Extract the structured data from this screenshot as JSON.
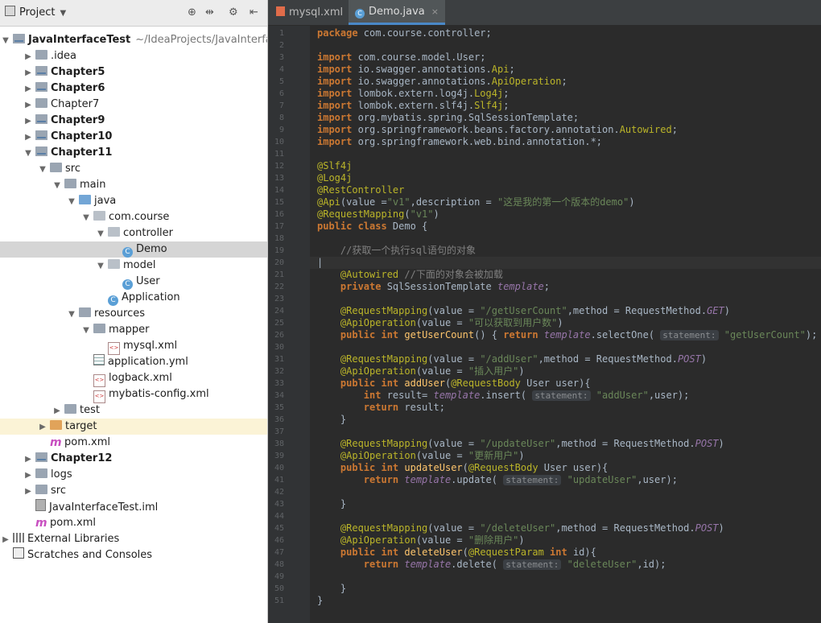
{
  "project": {
    "title": "Project",
    "tree": [
      {
        "label": "JavaInterfaceTest",
        "path": "~/IdeaProjects/JavaInterface",
        "bold": true,
        "depth": 0,
        "arrow": "▼",
        "icon": "module-folder"
      },
      {
        "label": ".idea",
        "depth": 1,
        "arrow": "▶",
        "icon": "folder"
      },
      {
        "label": "Chapter5",
        "bold": true,
        "depth": 1,
        "arrow": "▶",
        "icon": "module-folder"
      },
      {
        "label": "Chapter6",
        "bold": true,
        "depth": 1,
        "arrow": "▶",
        "icon": "module-folder"
      },
      {
        "label": "Chapter7",
        "depth": 1,
        "arrow": "▶",
        "icon": "folder"
      },
      {
        "label": "Chapter9",
        "bold": true,
        "depth": 1,
        "arrow": "▶",
        "icon": "module-folder"
      },
      {
        "label": "Chapter10",
        "bold": true,
        "depth": 1,
        "arrow": "▶",
        "icon": "module-folder"
      },
      {
        "label": "Chapter11",
        "bold": true,
        "depth": 1,
        "arrow": "▼",
        "icon": "module-folder"
      },
      {
        "label": "src",
        "depth": 2,
        "arrow": "▼",
        "icon": "folder"
      },
      {
        "label": "main",
        "depth": 3,
        "arrow": "▼",
        "icon": "folder"
      },
      {
        "label": "java",
        "depth": 4,
        "arrow": "▼",
        "icon": "folder-blue"
      },
      {
        "label": "com.course",
        "depth": 5,
        "arrow": "▼",
        "icon": "package"
      },
      {
        "label": "controller",
        "depth": 6,
        "arrow": "▼",
        "icon": "package"
      },
      {
        "label": "Demo",
        "depth": 7,
        "arrow": "",
        "icon": "class",
        "selected": true
      },
      {
        "label": "model",
        "depth": 6,
        "arrow": "▼",
        "icon": "package"
      },
      {
        "label": "User",
        "depth": 7,
        "arrow": "",
        "icon": "class"
      },
      {
        "label": "Application",
        "depth": 6,
        "arrow": "",
        "icon": "class"
      },
      {
        "label": "resources",
        "depth": 4,
        "arrow": "▼",
        "icon": "folder"
      },
      {
        "label": "mapper",
        "depth": 5,
        "arrow": "▼",
        "icon": "folder"
      },
      {
        "label": "mysql.xml",
        "depth": 6,
        "arrow": "",
        "icon": "xml"
      },
      {
        "label": "application.yml",
        "depth": 5,
        "arrow": "",
        "icon": "yml"
      },
      {
        "label": "logback.xml",
        "depth": 5,
        "arrow": "",
        "icon": "xml"
      },
      {
        "label": "mybatis-config.xml",
        "depth": 5,
        "arrow": "",
        "icon": "xml"
      },
      {
        "label": "test",
        "depth": 3,
        "arrow": "▶",
        "icon": "folder"
      },
      {
        "label": "target",
        "depth": 2,
        "arrow": "▶",
        "icon": "folder-orange",
        "highlight": true
      },
      {
        "label": "pom.xml",
        "depth": 2,
        "arrow": "",
        "icon": "maven"
      },
      {
        "label": "Chapter12",
        "bold": true,
        "depth": 1,
        "arrow": "▶",
        "icon": "module-folder"
      },
      {
        "label": "logs",
        "depth": 1,
        "arrow": "▶",
        "icon": "folder"
      },
      {
        "label": "src",
        "depth": 1,
        "arrow": "▶",
        "icon": "folder"
      },
      {
        "label": "JavaInterfaceTest.iml",
        "depth": 1,
        "arrow": "",
        "icon": "iml"
      },
      {
        "label": "pom.xml",
        "depth": 1,
        "arrow": "",
        "icon": "maven"
      },
      {
        "label": "External Libraries",
        "depth": 0,
        "arrow": "▶",
        "icon": "libraries"
      },
      {
        "label": "Scratches and Consoles",
        "depth": 0,
        "arrow": "",
        "icon": "scratches"
      }
    ]
  },
  "tabs": [
    {
      "label": "mysql.xml",
      "type": "xml",
      "active": false
    },
    {
      "label": "Demo.java",
      "type": "class",
      "active": true
    }
  ],
  "code_lines": [
    [
      [
        "kw",
        "package "
      ],
      [
        "",
        "com.course.controller;"
      ]
    ],
    [],
    [
      [
        "kw",
        "import "
      ],
      [
        "",
        "com.course.model.User;"
      ]
    ],
    [
      [
        "kw",
        "import "
      ],
      [
        "",
        "io.swagger.annotations."
      ],
      [
        "an",
        "Api"
      ],
      [
        "",
        ";"
      ]
    ],
    [
      [
        "kw",
        "import "
      ],
      [
        "",
        "io.swagger.annotations."
      ],
      [
        "an",
        "ApiOperation"
      ],
      [
        "",
        ";"
      ]
    ],
    [
      [
        "kw",
        "import "
      ],
      [
        "",
        "lombok.extern.log4j."
      ],
      [
        "an",
        "Log4j"
      ],
      [
        "",
        ";"
      ]
    ],
    [
      [
        "kw",
        "import "
      ],
      [
        "",
        "lombok.extern.slf4j."
      ],
      [
        "an",
        "Slf4j"
      ],
      [
        "",
        ";"
      ]
    ],
    [
      [
        "kw",
        "import "
      ],
      [
        "",
        "org.mybatis.spring.SqlSessionTemplate;"
      ]
    ],
    [
      [
        "kw",
        "import "
      ],
      [
        "",
        "org.springframework.beans.factory.annotation."
      ],
      [
        "an",
        "Autowired"
      ],
      [
        "",
        ";"
      ]
    ],
    [
      [
        "kw",
        "import "
      ],
      [
        "",
        "org.springframework.web.bind.annotation.*;"
      ]
    ],
    [],
    [
      [
        "an",
        "@Slf4j"
      ]
    ],
    [
      [
        "an",
        "@Log4j"
      ]
    ],
    [
      [
        "an",
        "@RestController"
      ]
    ],
    [
      [
        "an",
        "@Api"
      ],
      [
        "",
        "(value ="
      ],
      [
        "st",
        "\"v1\""
      ],
      [
        "",
        ",description = "
      ],
      [
        "st",
        "\"这是我的第一个版本的demo\""
      ],
      [
        "",
        ")"
      ]
    ],
    [
      [
        "an",
        "@RequestMapping"
      ],
      [
        "",
        "("
      ],
      [
        "st",
        "\"v1\""
      ],
      [
        "",
        ")"
      ]
    ],
    [
      [
        "kw",
        "public class "
      ],
      [
        "",
        "Demo {"
      ]
    ],
    [],
    [
      [
        "",
        "    "
      ],
      [
        "cm",
        "//获取一个执行sql语句的对象"
      ]
    ],
    [
      [
        "",
        "|"
      ]
    ],
    [
      [
        "",
        "    "
      ],
      [
        "an",
        "@Autowired "
      ],
      [
        "cm",
        "//下面的对象会被加载"
      ]
    ],
    [
      [
        "",
        "    "
      ],
      [
        "kw",
        "private "
      ],
      [
        "",
        "SqlSessionTemplate "
      ],
      [
        "it",
        "template"
      ],
      [
        "",
        ";"
      ]
    ],
    [],
    [
      [
        "",
        "    "
      ],
      [
        "an",
        "@RequestMapping"
      ],
      [
        "",
        "(value = "
      ],
      [
        "st",
        "\"/getUserCount\""
      ],
      [
        "",
        ",method = RequestMethod."
      ],
      [
        "it",
        "GET"
      ],
      [
        "",
        ")"
      ]
    ],
    [
      [
        "",
        "    "
      ],
      [
        "an",
        "@ApiOperation"
      ],
      [
        "",
        "(value = "
      ],
      [
        "st",
        "\"可以获取到用户数\""
      ],
      [
        "",
        ")"
      ]
    ],
    [
      [
        "",
        "    "
      ],
      [
        "kw",
        "public int "
      ],
      [
        "fn",
        "getUserCount"
      ],
      [
        "",
        "() { "
      ],
      [
        "kw",
        "return "
      ],
      [
        "it",
        "template"
      ],
      [
        "",
        ".selectOne( "
      ],
      [
        "hint",
        "statement:"
      ],
      [
        "st",
        " \"getUserCount\""
      ],
      [
        "",
        "); }"
      ]
    ],
    [],
    [
      [
        "",
        "    "
      ],
      [
        "an",
        "@RequestMapping"
      ],
      [
        "",
        "(value = "
      ],
      [
        "st",
        "\"/addUser\""
      ],
      [
        "",
        ",method = RequestMethod."
      ],
      [
        "it",
        "POST"
      ],
      [
        "",
        ")"
      ]
    ],
    [
      [
        "",
        "    "
      ],
      [
        "an",
        "@ApiOperation"
      ],
      [
        "",
        "(value = "
      ],
      [
        "st",
        "\"插入用户\""
      ],
      [
        "",
        ")"
      ]
    ],
    [
      [
        "",
        "    "
      ],
      [
        "kw",
        "public int "
      ],
      [
        "fn",
        "addUser"
      ],
      [
        "",
        "("
      ],
      [
        "an",
        "@RequestBody "
      ],
      [
        "",
        "User user){"
      ]
    ],
    [
      [
        "",
        "        "
      ],
      [
        "kw",
        "int "
      ],
      [
        "",
        "result= "
      ],
      [
        "it",
        "template"
      ],
      [
        "",
        ".insert( "
      ],
      [
        "hint",
        "statement:"
      ],
      [
        "st",
        " \"addUser\""
      ],
      [
        "",
        ",user);"
      ]
    ],
    [
      [
        "",
        "        "
      ],
      [
        "kw",
        "return "
      ],
      [
        "",
        "result;"
      ]
    ],
    [
      [
        "",
        "    }"
      ]
    ],
    [],
    [
      [
        "",
        "    "
      ],
      [
        "an",
        "@RequestMapping"
      ],
      [
        "",
        "(value = "
      ],
      [
        "st",
        "\"/updateUser\""
      ],
      [
        "",
        ",method = RequestMethod."
      ],
      [
        "it",
        "POST"
      ],
      [
        "",
        ")"
      ]
    ],
    [
      [
        "",
        "    "
      ],
      [
        "an",
        "@ApiOperation"
      ],
      [
        "",
        "(value = "
      ],
      [
        "st",
        "\"更新用户\""
      ],
      [
        "",
        ")"
      ]
    ],
    [
      [
        "",
        "    "
      ],
      [
        "kw",
        "public int "
      ],
      [
        "fn",
        "updateUser"
      ],
      [
        "",
        "("
      ],
      [
        "an",
        "@RequestBody "
      ],
      [
        "",
        "User user){"
      ]
    ],
    [
      [
        "",
        "        "
      ],
      [
        "kw",
        "return "
      ],
      [
        "it",
        "template"
      ],
      [
        "",
        ".update( "
      ],
      [
        "hint",
        "statement:"
      ],
      [
        "st",
        " \"updateUser\""
      ],
      [
        "",
        ",user);"
      ]
    ],
    [],
    [
      [
        "",
        "    }"
      ]
    ],
    [],
    [
      [
        "",
        "    "
      ],
      [
        "an",
        "@RequestMapping"
      ],
      [
        "",
        "(value = "
      ],
      [
        "st",
        "\"/deleteUser\""
      ],
      [
        "",
        ",method = RequestMethod."
      ],
      [
        "it",
        "POST"
      ],
      [
        "",
        ")"
      ]
    ],
    [
      [
        "",
        "    "
      ],
      [
        "an",
        "@ApiOperation"
      ],
      [
        "",
        "(value = "
      ],
      [
        "st",
        "\"删除用户\""
      ],
      [
        "",
        ")"
      ]
    ],
    [
      [
        "",
        "    "
      ],
      [
        "kw",
        "public int "
      ],
      [
        "fn",
        "deleteUser"
      ],
      [
        "",
        "("
      ],
      [
        "an",
        "@RequestParam "
      ],
      [
        "kw",
        "int "
      ],
      [
        "",
        "id){"
      ]
    ],
    [
      [
        "",
        "        "
      ],
      [
        "kw",
        "return "
      ],
      [
        "it",
        "template"
      ],
      [
        "",
        ".delete( "
      ],
      [
        "hint",
        "statement:"
      ],
      [
        "st",
        " \"deleteUser\""
      ],
      [
        "",
        ",id);"
      ]
    ],
    [],
    [
      [
        "",
        "    }"
      ]
    ],
    [
      [
        "",
        "}"
      ]
    ],
    []
  ],
  "line_numbers": [
    "1",
    "2",
    "3",
    "4",
    "5",
    "6",
    "7",
    "8",
    "9",
    "10",
    "11",
    "12",
    "13",
    "14",
    "15",
    "16",
    "17",
    "18",
    "19",
    "20",
    "21",
    "22",
    "23",
    "24",
    "25",
    "26",
    "30",
    "31",
    "32",
    "33",
    "34",
    "35",
    "36",
    "37",
    "38",
    "39",
    "40",
    "41",
    "42",
    "43",
    "44",
    "45",
    "46",
    "47",
    "48",
    "49",
    "50",
    "51"
  ],
  "current_line_index": 19,
  "colors": {
    "keyword": "#cc7832",
    "annotation": "#bbb529",
    "string": "#6a8759",
    "comment": "#808080",
    "field": "#9876aa",
    "method": "#ffc66d",
    "editor_bg": "#2b2b2b"
  }
}
